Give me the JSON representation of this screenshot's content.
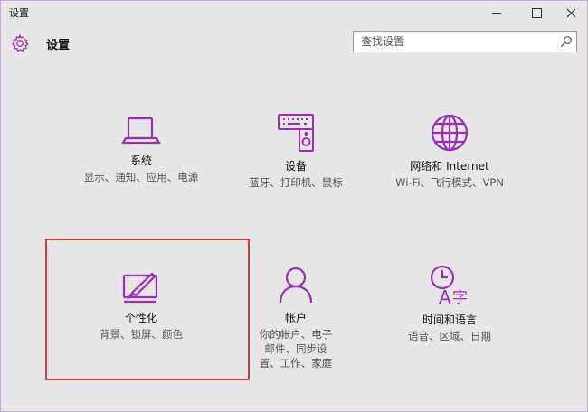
{
  "window": {
    "title": "设置",
    "accent": "#9b2fb2"
  },
  "header": {
    "title": "设置",
    "search_placeholder": "查找设置"
  },
  "tiles": [
    {
      "name": "系统",
      "desc": "显示、通知、应用、电源",
      "icon": "laptop-icon"
    },
    {
      "name": "设备",
      "desc": "蓝牙、打印机、鼠标",
      "icon": "devices-icon"
    },
    {
      "name": "网络和 Internet",
      "desc": "Wi-Fi、飞行模式、VPN",
      "icon": "globe-icon"
    },
    {
      "name": "个性化",
      "desc": "背景、锁屏、颜色",
      "icon": "personalization-icon"
    },
    {
      "name": "帐户",
      "desc": "你的帐户、电子邮件、同步设置、工作、家庭",
      "icon": "account-icon"
    },
    {
      "name": "时间和语言",
      "desc": "语音、区域、日期",
      "icon": "time-language-icon"
    }
  ],
  "highlight_color": "#d83a3a"
}
